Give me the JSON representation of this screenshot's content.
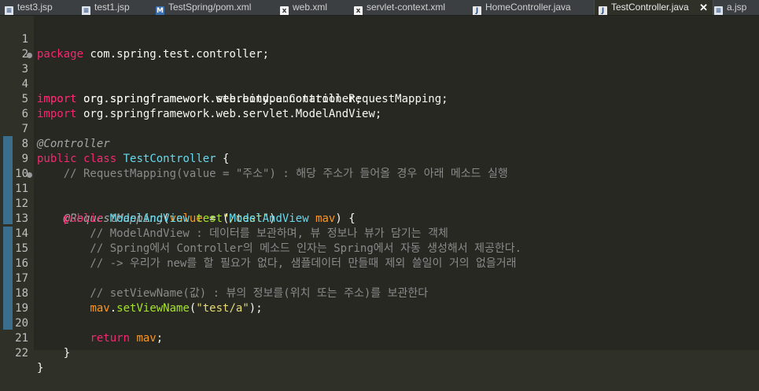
{
  "tabs": [
    {
      "label": "test3.jsp",
      "icon": "jsp-file-icon"
    },
    {
      "label": "test1.jsp",
      "icon": "jsp-file-icon"
    },
    {
      "label": "TestSpring/pom.xml",
      "icon": "maven-pom-icon"
    },
    {
      "label": "web.xml",
      "icon": "xml-file-icon"
    },
    {
      "label": "servlet-context.xml",
      "icon": "xml-file-icon"
    },
    {
      "label": "HomeController.java",
      "icon": "java-file-icon"
    },
    {
      "label": "TestController.java",
      "icon": "java-file-icon",
      "active": true,
      "close": "✕"
    },
    {
      "label": "a.jsp",
      "icon": "jsp-file-icon"
    }
  ],
  "colors": {
    "keyword": "#f92672",
    "type": "#66d9ef",
    "string": "#e6db74",
    "comment": "#8a8a8a",
    "variable": "#fd971f",
    "background": "#272822"
  },
  "lines": [
    {
      "n": "1"
    },
    {
      "n": "2"
    },
    {
      "n": "3"
    },
    {
      "n": "4"
    },
    {
      "n": "5"
    },
    {
      "n": "6"
    },
    {
      "n": "7"
    },
    {
      "n": "8"
    },
    {
      "n": "9"
    },
    {
      "n": "10"
    },
    {
      "n": "11"
    },
    {
      "n": "12"
    },
    {
      "n": "13"
    },
    {
      "n": "14"
    },
    {
      "n": "15"
    },
    {
      "n": "16"
    },
    {
      "n": "17"
    },
    {
      "n": "18"
    },
    {
      "n": "19"
    },
    {
      "n": "20"
    },
    {
      "n": "21"
    },
    {
      "n": "22"
    }
  ],
  "code": {
    "l1": {
      "kw": "package",
      "rest": " com.spring.test.controller;"
    },
    "l3": {
      "kw": "import",
      "rest": " org.springframework.stereotype.Controller;"
    },
    "l4": {
      "kw": "import",
      "rest": " org.springframework.web.bind.annotation.RequestMapping;"
    },
    "l5": {
      "kw": "import",
      "rest": " org.springframework.web.servlet.ModelAndView;"
    },
    "l7": {
      "ann": "@Controller"
    },
    "l8": {
      "kw": "public",
      "kw2": "class",
      "name": "TestController",
      "rest": " {"
    },
    "l9": {
      "comment": "    // RequestMapping(value = \"주소\") : 해당 주소가 들어올 경우 아래 메소드 실행"
    },
    "l11": {
      "ann": "@RequestMapping",
      "p1": "(",
      "attr": "value",
      "eq": " = ",
      "str": "\"/test\"",
      "p2": ")"
    },
    "l12": {
      "kw": "public",
      "type": "ModelAndView",
      "fn": "test",
      "p1": "(",
      "ptype": "ModelAndView",
      "var": "mav",
      "p2": ") {"
    },
    "l13": {
      "comment": "        // ModelAndView : 데이터를 보관하며, 뷰 정보나 뷰가 담기는 객체"
    },
    "l14": {
      "comment": "        // Spring에서 Controller의 메소드 인자는 Spring에서 자동 생성해서 제공한다."
    },
    "l15": {
      "comment": "        // -> 우리가 new를 할 필요가 없다, 샘플데이터 만들때 제외 쓸일이 거의 없을거래"
    },
    "l17": {
      "comment": "        // setViewName(값) : 뷰의 정보를(위치 또는 주소)를 보관한다"
    },
    "l18": {
      "var": "mav",
      "dot": ".",
      "fn": "setViewName",
      "p1": "(",
      "str": "\"test/a\"",
      "p2": ");"
    },
    "l20": {
      "kw": "return",
      "var": "mav",
      "semi": ";"
    },
    "l21": {
      "brace": "    }"
    },
    "l22": {
      "brace": "}"
    }
  }
}
